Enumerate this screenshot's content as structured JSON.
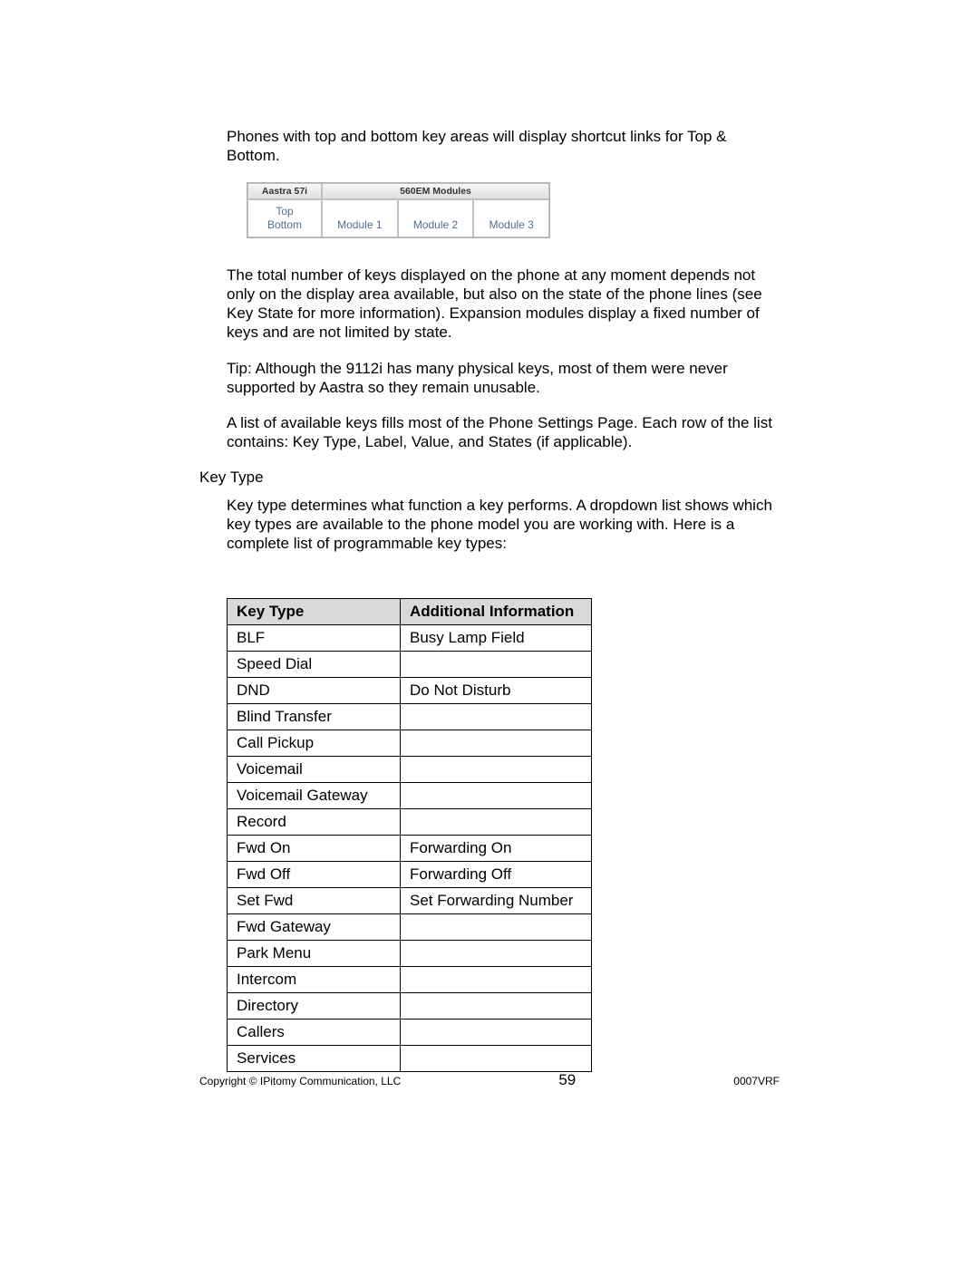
{
  "paragraphs": {
    "p1": "Phones with top and bottom key areas will display shortcut links for Top & Bottom.",
    "p2": "The total number of keys displayed on the phone at any moment depends not only on the display area available, but also on the state of the phone lines (see Key State for more information). Expansion modules display a fixed number of keys and are not limited by state.",
    "p3": "Tip: Although the 9112i has many physical keys, most of them were never supported by Aastra so they remain unusable.",
    "p4": "A list of available keys fills most of the Phone Settings Page. Each row of the list contains: Key Type, Label, Value, and States (if applicable).",
    "p5": "Key type determines what function a key performs. A dropdown list shows which key types are available to the phone model you are working with. Here is a complete list of programmable key types:"
  },
  "section_label": "Key Type",
  "module_box": {
    "hdr_left": "Aastra 57i",
    "hdr_right": "560EM Modules",
    "left_top": "Top",
    "left_bottom": "Bottom",
    "mods": [
      "Module 1",
      "Module 2",
      "Module 3"
    ]
  },
  "table": {
    "headers": {
      "type": "Key Type",
      "info": "Additional Information"
    },
    "rows": [
      {
        "type": "BLF",
        "info": "Busy Lamp Field"
      },
      {
        "type": "Speed Dial",
        "info": ""
      },
      {
        "type": "DND",
        "info": "Do Not Disturb"
      },
      {
        "type": "Blind Transfer",
        "info": ""
      },
      {
        "type": "Call Pickup",
        "info": ""
      },
      {
        "type": "Voicemail",
        "info": ""
      },
      {
        "type": "Voicemail Gateway",
        "info": ""
      },
      {
        "type": "Record",
        "info": ""
      },
      {
        "type": "Fwd On",
        "info": "Forwarding On"
      },
      {
        "type": "Fwd Off",
        "info": "Forwarding Off"
      },
      {
        "type": "Set Fwd",
        "info": "Set Forwarding Number"
      },
      {
        "type": "Fwd Gateway",
        "info": ""
      },
      {
        "type": "Park Menu",
        "info": ""
      },
      {
        "type": "Intercom",
        "info": ""
      },
      {
        "type": "Directory",
        "info": ""
      },
      {
        "type": "Callers",
        "info": ""
      },
      {
        "type": "Services",
        "info": ""
      }
    ]
  },
  "footer": {
    "left": "Copyright © IPitomy Communication, LLC",
    "center": "59",
    "right": "0007VRF"
  }
}
